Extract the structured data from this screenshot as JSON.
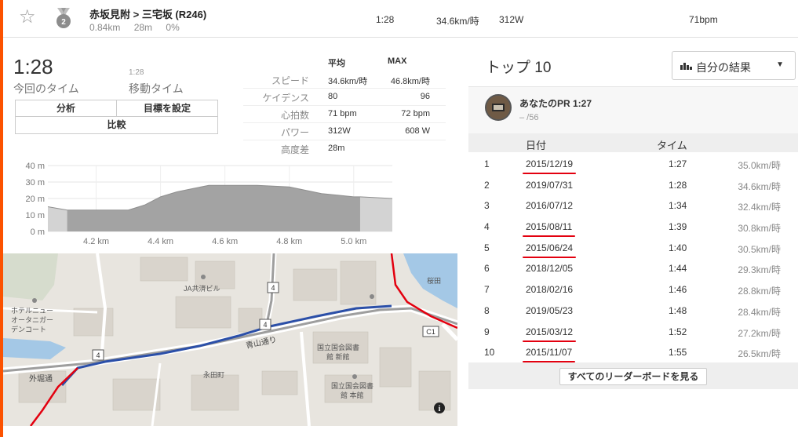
{
  "segment": {
    "name": "赤坂見附 > 三宅坂 (R246)",
    "distance": "0.84km",
    "elevation": "28m",
    "grade": "0%",
    "medal_rank": "2",
    "row_time": "1:28",
    "row_speed": "34.6km/時",
    "row_power": "312W",
    "row_hr": "71bpm"
  },
  "summary": {
    "elapsed_time": "1:28",
    "elapsed_label": "今回のタイム",
    "moving_time_small": "1:28",
    "moving_label": "移動タイム"
  },
  "buttons": {
    "analyze": "分析",
    "set_goal": "目標を設定",
    "compare": "比較"
  },
  "stats": {
    "header_avg": "平均",
    "header_max": "MAX",
    "rows": [
      {
        "label": "スピード",
        "avg": "34.6km/時",
        "max": "46.8km/時"
      },
      {
        "label": "ケイデンス",
        "avg": "80",
        "max": "96"
      },
      {
        "label": "心拍数",
        "avg": "71 bpm",
        "max": "72 bpm"
      },
      {
        "label": "パワー",
        "avg": "312W",
        "max": "608 W"
      },
      {
        "label": "高度差",
        "avg": "28m",
        "max": ""
      }
    ]
  },
  "chart_data": {
    "type": "area",
    "xlabel": "",
    "ylabel": "",
    "xlim": [
      4.05,
      5.12
    ],
    "ylim": [
      0,
      40
    ],
    "x_ticks": [
      "4.2 km",
      "4.4 km",
      "4.6 km",
      "4.8 km",
      "5.0 km"
    ],
    "x_tick_values": [
      4.2,
      4.4,
      4.6,
      4.8,
      5.0
    ],
    "y_ticks": [
      "0 m",
      "10 m",
      "20 m",
      "30 m",
      "40 m"
    ],
    "y_tick_values": [
      0,
      10,
      20,
      30,
      40
    ],
    "segment_range": [
      4.11,
      5.02
    ],
    "x": [
      4.05,
      4.08,
      4.11,
      4.2,
      4.3,
      4.35,
      4.4,
      4.45,
      4.5,
      4.55,
      4.6,
      4.7,
      4.8,
      4.85,
      4.9,
      4.95,
      5.0,
      5.02,
      5.12
    ],
    "y": [
      15,
      14,
      13,
      13,
      13,
      16,
      21,
      24,
      26,
      28,
      28,
      28,
      27,
      25,
      23,
      22,
      21,
      21,
      20
    ],
    "colors": {
      "selected": "#a3a3a3",
      "outside": "#d3d3d3"
    }
  },
  "map": {
    "labels": [
      "JA共済ビル",
      "ホテルニュー",
      "オータニガー",
      "デンコート",
      "青山通り",
      "外堀通",
      "永田町",
      "国立国会図書",
      "館 新館",
      "国立国会図書",
      "館 本館",
      "C1",
      "4",
      "4",
      "4",
      "桜田"
    ],
    "info_icon": "info-icon",
    "route_color": "#2b4fa8",
    "boundary_color": "#e3000f"
  },
  "leaderboard": {
    "title": "トップ 10",
    "filter_label": "自分の結果",
    "pr_title": "あなたのPR 1:27",
    "pr_sub": "– /56",
    "col_date": "日付",
    "col_time": "タイム",
    "rows": [
      {
        "rank": "1",
        "date": "2015/12/19",
        "time": "1:27",
        "speed": "35.0km/時",
        "underlined": true
      },
      {
        "rank": "2",
        "date": "2019/07/31",
        "time": "1:28",
        "speed": "34.6km/時",
        "underlined": false
      },
      {
        "rank": "3",
        "date": "2016/07/12",
        "time": "1:34",
        "speed": "32.4km/時",
        "underlined": false
      },
      {
        "rank": "4",
        "date": "2015/08/11",
        "time": "1:39",
        "speed": "30.8km/時",
        "underlined": true
      },
      {
        "rank": "5",
        "date": "2015/06/24",
        "time": "1:40",
        "speed": "30.5km/時",
        "underlined": true
      },
      {
        "rank": "6",
        "date": "2018/12/05",
        "time": "1:44",
        "speed": "29.3km/時",
        "underlined": false
      },
      {
        "rank": "7",
        "date": "2018/02/16",
        "time": "1:46",
        "speed": "28.8km/時",
        "underlined": false
      },
      {
        "rank": "8",
        "date": "2019/05/23",
        "time": "1:48",
        "speed": "28.4km/時",
        "underlined": false
      },
      {
        "rank": "9",
        "date": "2015/03/12",
        "time": "1:52",
        "speed": "27.2km/時",
        "underlined": true
      },
      {
        "rank": "10",
        "date": "2015/11/07",
        "time": "1:55",
        "speed": "26.5km/時",
        "underlined": true
      }
    ],
    "see_all": "すべてのリーダーボードを見る"
  }
}
